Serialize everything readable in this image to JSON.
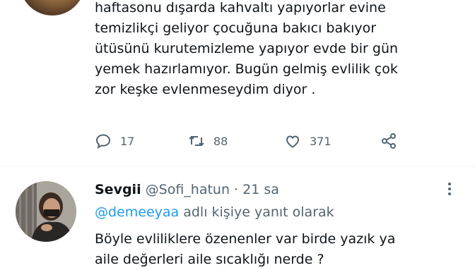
{
  "tweet": {
    "body": "haftasonu dışarda kahvaltı yapıyorlar evine\ntemizlikçi geliyor çocuğuna bakıcı bakıyor\nütüsünü kurutemizleme yapıyor evde bir gün\nyemek hazırlamıyor. Bugün gelmiş evlilik çok\nzor keşke evlenmeseydim diyor .",
    "actions": {
      "reply_count": "17",
      "retweet_count": "88",
      "like_count": "371"
    }
  },
  "reply": {
    "display_name": "Sevgii",
    "handle": "@Sofi_hatun",
    "separator": "·",
    "time": "21 sa",
    "replying_to_mention": "@demeeyaa",
    "replying_to_suffix": " adlı kişiye yanıt olarak",
    "text": "Böyle evliliklere özenenler var birde yazık ya\naile değerleri aile sıcaklığı nerde ?"
  },
  "colors": {
    "text": "#0f1419",
    "secondary": "#536471",
    "accent": "#1d9bf0",
    "divider": "#eff3f4"
  },
  "icons": [
    "reply-icon",
    "retweet-icon",
    "like-icon",
    "share-icon",
    "more-icon"
  ]
}
